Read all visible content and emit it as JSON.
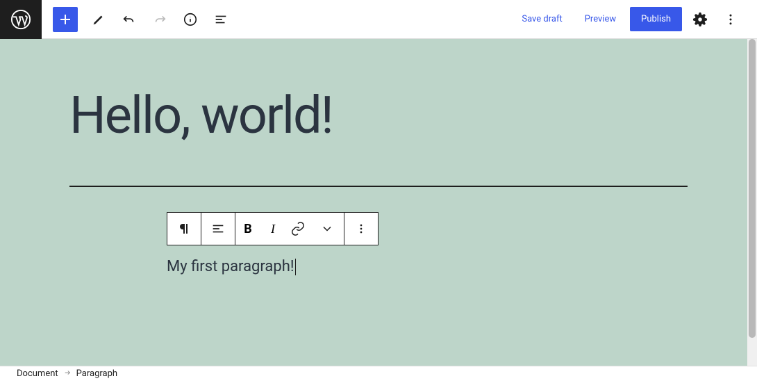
{
  "header": {
    "save_draft": "Save draft",
    "preview": "Preview",
    "publish": "Publish"
  },
  "editor": {
    "title": "Hello, world!",
    "paragraph": "My first paragraph!"
  },
  "toolbar": {
    "bold": "B",
    "italic": "I"
  },
  "breadcrumb": {
    "root": "Document",
    "current": "Paragraph"
  }
}
